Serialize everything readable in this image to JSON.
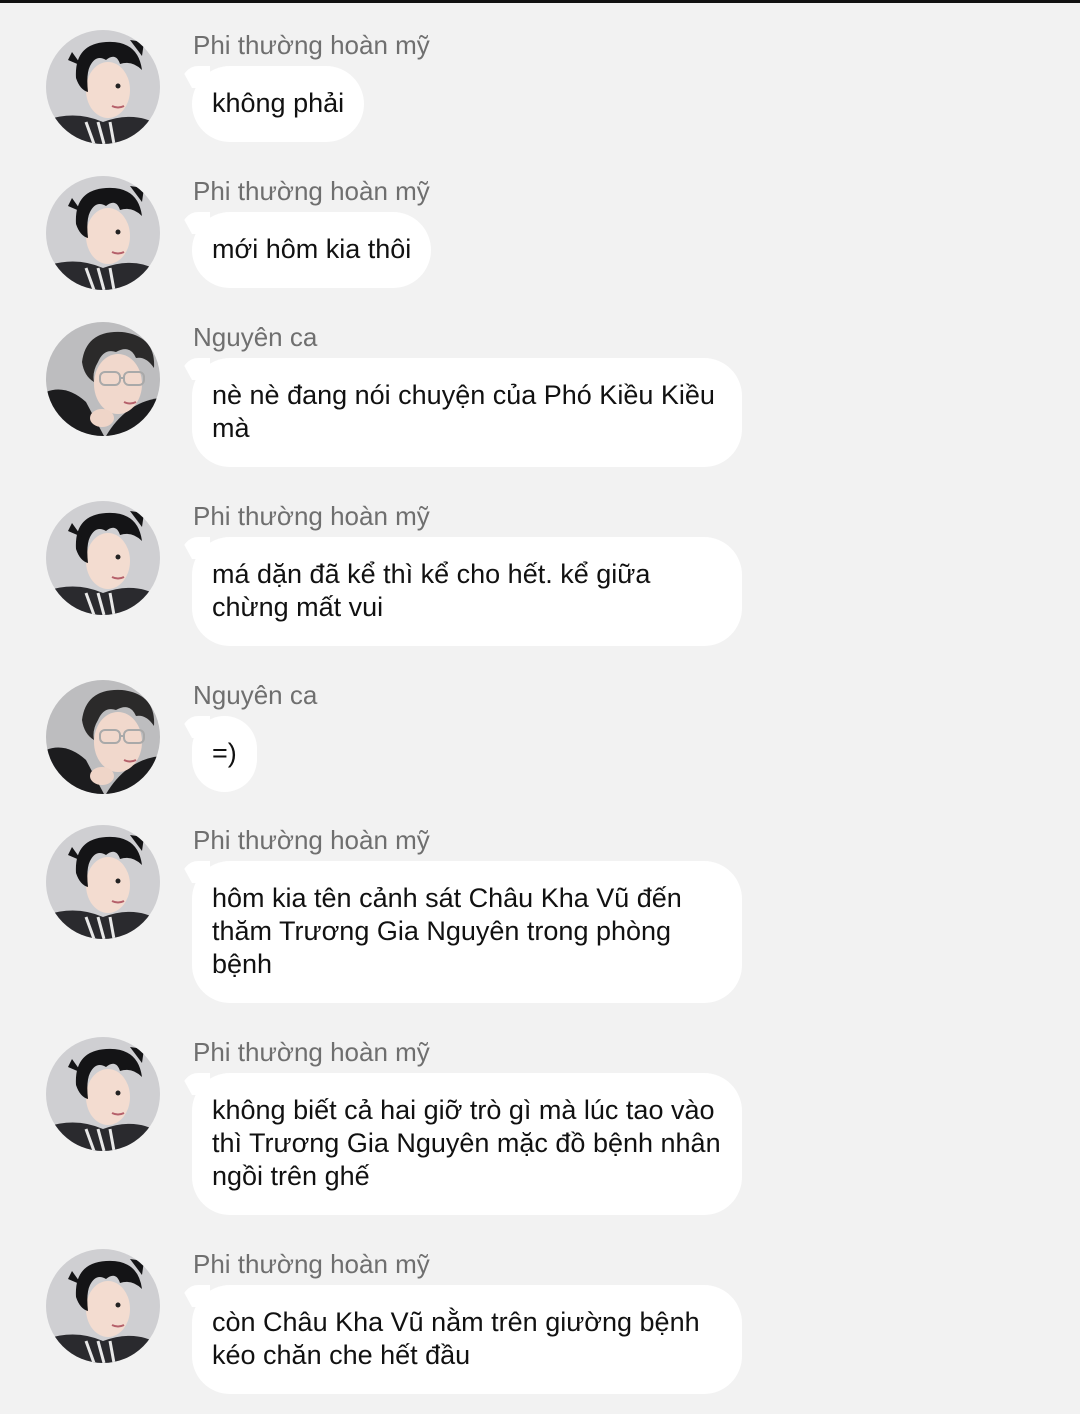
{
  "conversation": {
    "messages": [
      {
        "sender": "Phi thường hoàn mỹ",
        "avatar": "avatar-phi",
        "text": "không phải"
      },
      {
        "sender": "Phi thường hoàn mỹ",
        "avatar": "avatar-phi",
        "text": "mới hôm kia thôi"
      },
      {
        "sender": "Nguyên ca",
        "avatar": "avatar-nguyen",
        "text": "nè nè đang nói chuyện của Phó Kiều Kiều mà"
      },
      {
        "sender": "Phi thường hoàn mỹ",
        "avatar": "avatar-phi",
        "text": "má dặn đã kể thì kể cho hết. kể giữa chừng mất vui"
      },
      {
        "sender": "Nguyên ca",
        "avatar": "avatar-nguyen",
        "text": "=)"
      },
      {
        "sender": "Phi thường hoàn mỹ",
        "avatar": "avatar-phi",
        "text": "hôm kia tên cảnh sát Châu Kha Vũ đến thăm Trương Gia Nguyên trong phòng bệnh"
      },
      {
        "sender": "Phi thường hoàn mỹ",
        "avatar": "avatar-phi",
        "text": "không biết cả hai giỡ trò gì mà lúc tao vào thì Trương Gia Nguyên mặc đồ bệnh nhân ngồi trên ghế"
      },
      {
        "sender": "Phi thường hoàn mỹ",
        "avatar": "avatar-phi",
        "text": "còn Châu Kha Vũ nằm trên giường bệnh kéo chăn che hết đầu"
      }
    ]
  },
  "colors": {
    "background": "#f2f2f2",
    "bubble": "#ffffff",
    "sender_name": "#6f6f6f",
    "message_text": "#111111"
  }
}
